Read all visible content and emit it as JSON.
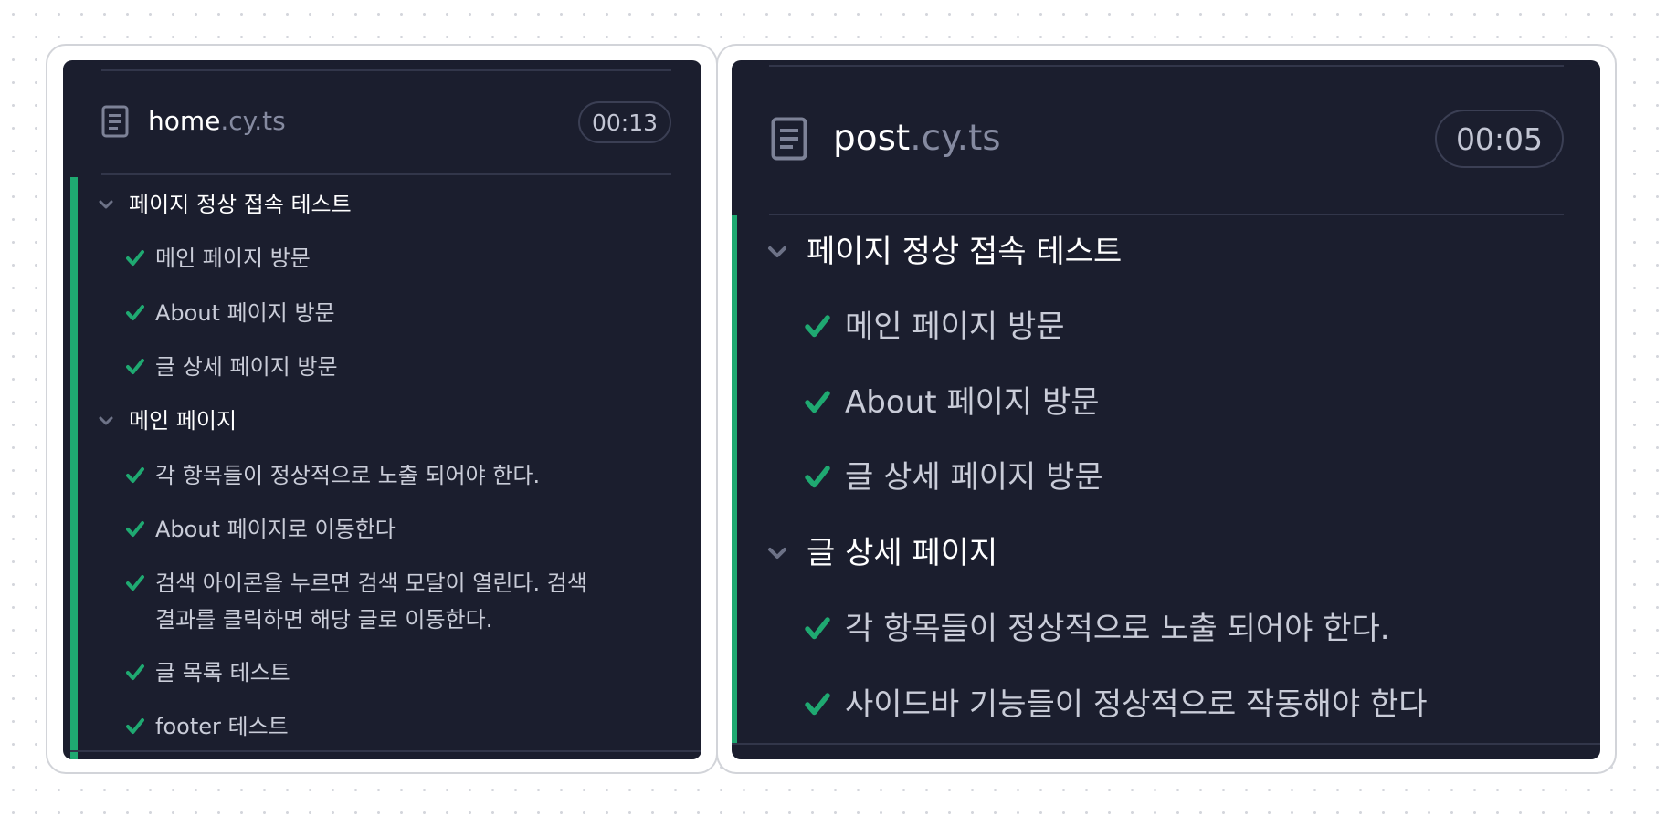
{
  "panels": [
    {
      "file": {
        "name": "home",
        "ext": ".cy.ts",
        "icon": "file-document-icon"
      },
      "duration": "00:13",
      "suites": [
        {
          "title": "페이지 정상 접속 테스트",
          "tests": [
            {
              "title": "메인 페이지 방문",
              "status": "passed"
            },
            {
              "title": "About 페이지 방문",
              "status": "passed"
            },
            {
              "title": "글 상세 페이지 방문",
              "status": "passed"
            }
          ]
        },
        {
          "title": "메인 페이지",
          "tests": [
            {
              "title": "각 항목들이 정상적으로 노출 되어야 한다.",
              "status": "passed"
            },
            {
              "title": "About 페이지로 이동한다",
              "status": "passed"
            },
            {
              "title_line1": "검색 아이콘을 누르면 검색 모달이 열린다. 검색",
              "title_line2": "결과를 클릭하면 해당 글로 이동한다.",
              "status": "passed"
            },
            {
              "title": "글 목록 테스트",
              "status": "passed"
            },
            {
              "title": "footer 테스트",
              "status": "passed"
            }
          ]
        }
      ]
    },
    {
      "file": {
        "name": "post",
        "ext": ".cy.ts",
        "icon": "file-document-icon"
      },
      "duration": "00:05",
      "suites": [
        {
          "title": "페이지 정상 접속 테스트",
          "tests": [
            {
              "title": "메인 페이지 방문",
              "status": "passed"
            },
            {
              "title": "About 페이지 방문",
              "status": "passed"
            },
            {
              "title": "글 상세 페이지 방문",
              "status": "passed"
            }
          ]
        },
        {
          "title": "글 상세 페이지",
          "tests": [
            {
              "title": "각 항목들이 정상적으로 노출 되어야 한다.",
              "status": "passed"
            },
            {
              "title": "사이드바 기능들이 정상적으로 작동해야 한다",
              "status": "passed"
            }
          ]
        }
      ]
    }
  ],
  "colors": {
    "panel_bg": "#1b1e2e",
    "pass_green": "#1fa971",
    "divider": "#32364a",
    "muted_ext": "#858aa0"
  }
}
